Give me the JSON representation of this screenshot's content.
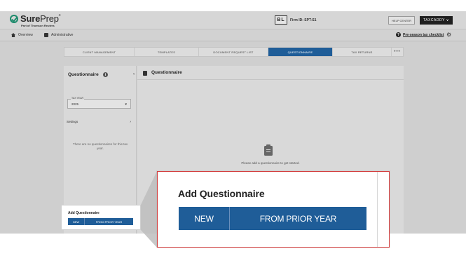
{
  "header": {
    "brand_name_bold": "Sure",
    "brand_name_light": "Prep",
    "brand_tagline": "Part of Thomson Reuters",
    "firm_badge": "BL",
    "firm_id": "Firm ID: SPT-S1",
    "help_label": "HELP CENTER",
    "taxcaddy_label": "TAXCADDY ∨"
  },
  "navbar": {
    "overview": "Overview",
    "administrative": "Administrative",
    "checklist": "Pre-season tax checklist"
  },
  "tabs": [
    {
      "label": "CLIENT MANAGEMENT",
      "active": false
    },
    {
      "label": "TEMPLATES",
      "active": false
    },
    {
      "label": "DOCUMENT REQUEST LIST",
      "active": false
    },
    {
      "label": "QUESTIONNAIRE",
      "active": true
    },
    {
      "label": "TAX RETURNS",
      "active": false
    },
    {
      "label": "•••",
      "active": false
    }
  ],
  "left_panel": {
    "title": "Questionnaire",
    "tax_year_caption": "TAX YEAR",
    "tax_year_value": "2025",
    "settings_label": "Settings",
    "empty_text": "There are no questionnaires for this tax year."
  },
  "main_panel": {
    "title": "Questionnaire",
    "empty_text": "Please add a questionnaire to get started."
  },
  "callout": {
    "title": "Add Questionnaire",
    "new_label": "NEW",
    "prior_label": "FROM PRIOR YEAR"
  },
  "colors": {
    "accent": "#1f5d98",
    "highlight_border": "#d33c3c",
    "brand_green": "#1c8a6b"
  }
}
